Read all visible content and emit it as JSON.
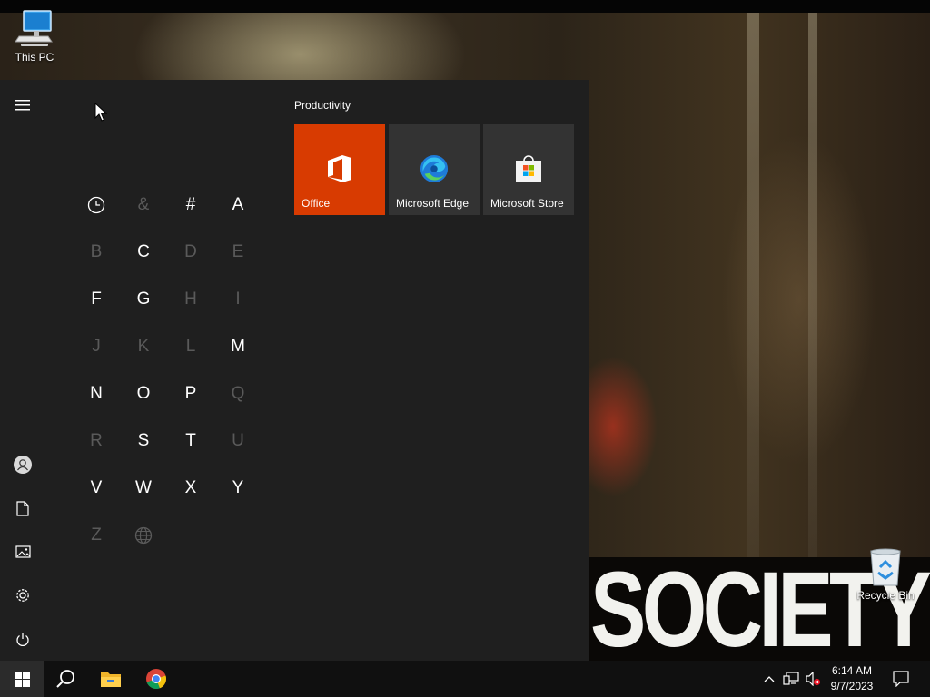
{
  "desktop": {
    "icons": [
      {
        "label": "This PC"
      },
      {
        "label": "Recycle Bin"
      }
    ],
    "wallpaper_text": "SOCIETY"
  },
  "start_menu": {
    "rail": {
      "items": [
        "hamburger-menu-icon",
        "user-icon",
        "documents-icon",
        "pictures-icon",
        "settings-icon",
        "power-icon"
      ]
    },
    "letters": [
      {
        "char": "clock",
        "enabled": true
      },
      {
        "char": "&",
        "enabled": false
      },
      {
        "char": "#",
        "enabled": true
      },
      {
        "char": "A",
        "enabled": true
      },
      {
        "char": "B",
        "enabled": false
      },
      {
        "char": "C",
        "enabled": true
      },
      {
        "char": "D",
        "enabled": false
      },
      {
        "char": "E",
        "enabled": false
      },
      {
        "char": "F",
        "enabled": true
      },
      {
        "char": "G",
        "enabled": true
      },
      {
        "char": "H",
        "enabled": false
      },
      {
        "char": "I",
        "enabled": false
      },
      {
        "char": "J",
        "enabled": false
      },
      {
        "char": "K",
        "enabled": false
      },
      {
        "char": "L",
        "enabled": false
      },
      {
        "char": "M",
        "enabled": true
      },
      {
        "char": "N",
        "enabled": true
      },
      {
        "char": "O",
        "enabled": true
      },
      {
        "char": "P",
        "enabled": true
      },
      {
        "char": "Q",
        "enabled": false
      },
      {
        "char": "R",
        "enabled": false
      },
      {
        "char": "S",
        "enabled": true
      },
      {
        "char": "T",
        "enabled": true
      },
      {
        "char": "U",
        "enabled": false
      },
      {
        "char": "V",
        "enabled": true
      },
      {
        "char": "W",
        "enabled": true
      },
      {
        "char": "X",
        "enabled": true
      },
      {
        "char": "Y",
        "enabled": true
      },
      {
        "char": "Z",
        "enabled": false
      },
      {
        "char": "globe",
        "enabled": false
      }
    ],
    "group_title": "Productivity",
    "tiles": [
      {
        "label": "Office",
        "color": "#d83b01"
      },
      {
        "label": "Microsoft Edge",
        "color": "#333333"
      },
      {
        "label": "Microsoft Store",
        "color": "#333333"
      }
    ]
  },
  "taskbar": {
    "pinned": [
      "windows-start-icon",
      "search-icon",
      "file-explorer-icon",
      "chrome-icon"
    ],
    "tray": [
      "show-hidden-icons-chevron-icon",
      "network-icon",
      "volume-muted-icon"
    ],
    "time": "6:14 AM",
    "date": "9/7/2023"
  },
  "colors": {
    "start_bg": "#1f1f1f",
    "tile_bg": "#333333",
    "office_orange": "#d83b01",
    "taskbar_bg": "#101010",
    "disabled_letter": "#5a5a5a"
  }
}
